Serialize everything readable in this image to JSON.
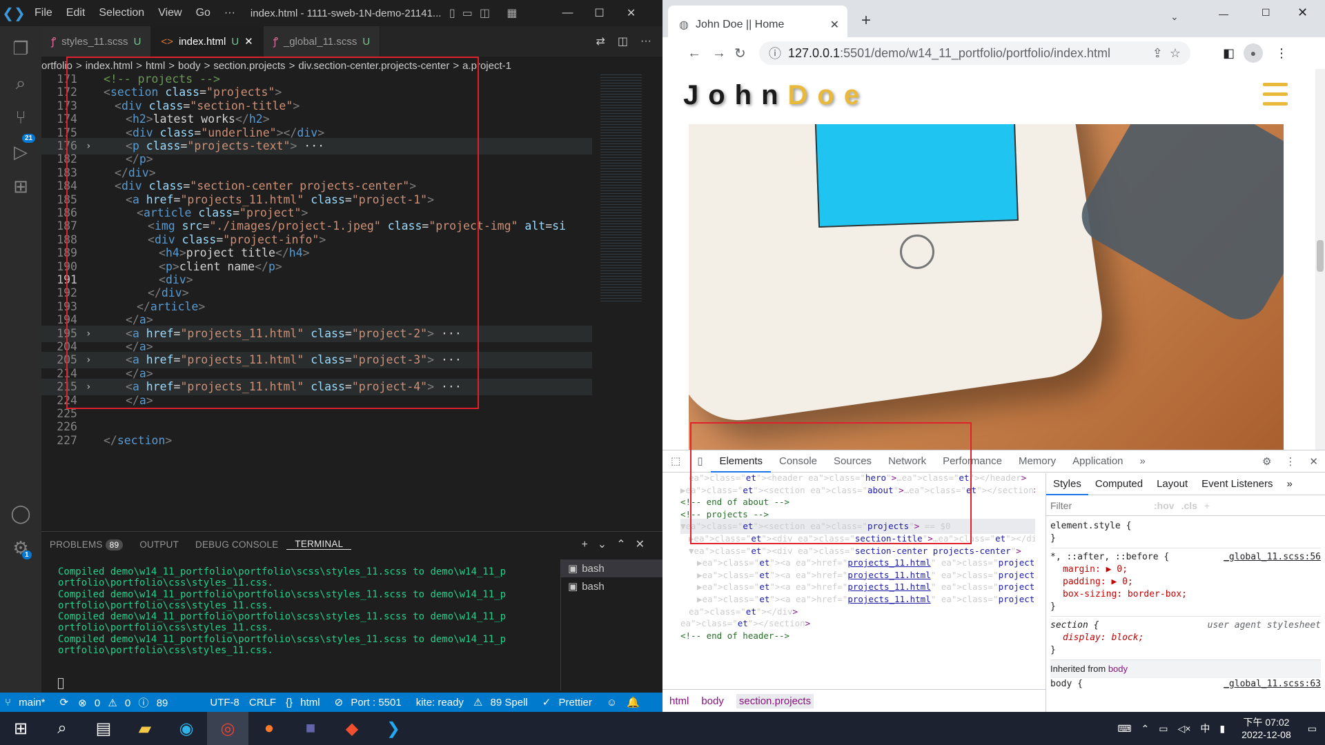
{
  "vscode": {
    "menu": [
      "File",
      "Edit",
      "Selection",
      "View",
      "Go",
      "···"
    ],
    "window_title": "index.html - 1111-sweb-1N-demo-21141...",
    "activity_badges": {
      "scm": "21",
      "accounts": "1"
    },
    "tabs": [
      {
        "name": "styles_11.scss",
        "status": "U"
      },
      {
        "name": "index.html",
        "status": "U"
      },
      {
        "name": "_global_11.scss",
        "status": "U"
      }
    ],
    "breadcrumbs": [
      "ortfolio",
      ">",
      "index.html",
      ">",
      "html",
      ">",
      "body",
      ">",
      "section.projects",
      ">",
      "div.section-center.projects-center",
      ">",
      "a.project-1"
    ],
    "lines": [
      {
        "n": "171",
        "code": "<!-- projects -->",
        "indent": 2
      },
      {
        "n": "172",
        "code": "<section class=\"projects\">",
        "indent": 2
      },
      {
        "n": "173",
        "code": "<div class=\"section-title\">",
        "indent": 3
      },
      {
        "n": "174",
        "code": "<h2>latest works</h2>",
        "indent": 4
      },
      {
        "n": "175",
        "code": "<div class=\"underline\"></div>",
        "indent": 4
      },
      {
        "n": "176",
        "code": "<p class=\"projects-text\"> ···",
        "indent": 4
      },
      {
        "n": "182",
        "code": "</p>",
        "indent": 4
      },
      {
        "n": "183",
        "code": "</div>",
        "indent": 3
      },
      {
        "n": "184",
        "code": "<div class=\"section-center projects-center\">",
        "indent": 3
      },
      {
        "n": "185",
        "code": "<a href=\"projects_11.html\" class=\"project-1\">",
        "indent": 4
      },
      {
        "n": "186",
        "code": "<article class=\"project\">",
        "indent": 5
      },
      {
        "n": "187",
        "code": "<img src=\"./images/project-1.jpeg\" class=\"project-img\" alt=\"si",
        "indent": 6
      },
      {
        "n": "188",
        "code": "<div class=\"project-info\">",
        "indent": 6
      },
      {
        "n": "189",
        "code": "<h4>project title</h4>",
        "indent": 7
      },
      {
        "n": "190",
        "code": "<p>client name</p>",
        "indent": 7
      },
      {
        "n": "191",
        "code": "<div>",
        "indent": 7
      },
      {
        "n": "192",
        "code": "</div>",
        "indent": 6
      },
      {
        "n": "193",
        "code": "</article>",
        "indent": 5
      },
      {
        "n": "194",
        "code": "</a>",
        "indent": 4
      },
      {
        "n": "195",
        "code": "<a href=\"projects_11.html\" class=\"project-2\"> ···",
        "indent": 4
      },
      {
        "n": "204",
        "code": "</a>",
        "indent": 4
      },
      {
        "n": "205",
        "code": "<a href=\"projects_11.html\" class=\"project-3\"> ···",
        "indent": 4
      },
      {
        "n": "214",
        "code": "</a>",
        "indent": 4
      },
      {
        "n": "215",
        "code": "<a href=\"projects_11.html\" class=\"project-4\"> ···",
        "indent": 4
      },
      {
        "n": "224",
        "code": "</a>",
        "indent": 4
      },
      {
        "n": "225",
        "code": "",
        "indent": 0
      },
      {
        "n": "226",
        "code": "",
        "indent": 0
      },
      {
        "n": "227",
        "code": "</section>",
        "indent": 2
      }
    ],
    "panel_tabs": [
      "PROBLEMS",
      "OUTPUT",
      "DEBUG CONSOLE",
      "TERMINAL"
    ],
    "problems_count": "89",
    "terminal_lines": [
      "Compiled demo\\w14_11_portfolio\\portfolio\\scss\\styles_11.scss to demo\\w14_11_p",
      "ortfolio\\portfolio\\css\\styles_11.css.",
      "Compiled demo\\w14_11_portfolio\\portfolio\\scss\\styles_11.scss to demo\\w14_11_p",
      "ortfolio\\portfolio\\css\\styles_11.css.",
      "Compiled demo\\w14_11_portfolio\\portfolio\\scss\\styles_11.scss to demo\\w14_11_p",
      "ortfolio\\portfolio\\css\\styles_11.css.",
      "Compiled demo\\w14_11_portfolio\\portfolio\\scss\\styles_11.scss to demo\\w14_11_p",
      "ortfolio\\portfolio\\css\\styles_11.css."
    ],
    "terminals": [
      "bash",
      "bash"
    ],
    "status": {
      "branch": "main*",
      "errors": "0",
      "warnings": "0",
      "info": "89",
      "encoding": "UTF-8",
      "eol": "CRLF",
      "language": "html",
      "port": "Port : 5501",
      "kite": "kite: ready",
      "spell": "89 Spell",
      "prettier": "Prettier"
    }
  },
  "chrome": {
    "tab_title": "John Doe || Home",
    "url_host": "127.0.0.1",
    "url_rest": ":5501/demo/w14_11_portfolio/portfolio/index.html",
    "logo_first": "John",
    "logo_last": "Doe",
    "devtools_tabs": [
      "Elements",
      "Console",
      "Sources",
      "Network",
      "Performance",
      "Memory",
      "Application"
    ],
    "elements": [
      {
        "t": "<header class=\"hero\">…</header>"
      },
      {
        "t": "▶<section class=\"about\">…</section>"
      },
      {
        "t": "<!-- end of about -->"
      },
      {
        "t": "<!-- projects -->"
      },
      {
        "t": "▼<section class=\"projects\"> == $0"
      },
      {
        "t": "▶<div class=\"section-title\">…</div>"
      },
      {
        "t": "▼<div class=\"section-center projects-center\">"
      },
      {
        "t": "▶<a href=\"projects_11.html\" class=\"project-1\">…</a>"
      },
      {
        "t": "▶<a href=\"projects_11.html\" class=\"project-2\">…</a>"
      },
      {
        "t": "▶<a href=\"projects_11.html\" class=\"project-3\">…</a>"
      },
      {
        "t": "▶<a href=\"projects_11.html\" class=\"project-4\">…</a>"
      },
      {
        "t": "</div>"
      },
      {
        "t": "</section>"
      },
      {
        "t": "<!-- end of header-->"
      }
    ],
    "style_tabs": [
      "Styles",
      "Computed",
      "Layout",
      "Event Listeners"
    ],
    "filter_placeholder": "Filter",
    "hov": ":hov",
    "cls": ".cls",
    "element_style": "element.style {",
    "rule1_selector": "*, ::after, ::before {",
    "rule1_source": "_global_11.scss:56",
    "rule1_props": [
      "margin: ▶ 0;",
      "padding: ▶ 0;",
      "box-sizing: border-box;"
    ],
    "rule2_selector": "section {",
    "rule2_source": "user agent stylesheet",
    "rule2_props": [
      "display: block;"
    ],
    "inherited": "Inherited from",
    "inherited_el": "body",
    "rule3_selector": "body {",
    "rule3_source": "_global_11.scss:63",
    "crumbs": [
      "html",
      "body",
      "section.projects"
    ]
  },
  "taskbar": {
    "time": "下午 07:02",
    "date": "2022-12-08",
    "ime": "中"
  }
}
